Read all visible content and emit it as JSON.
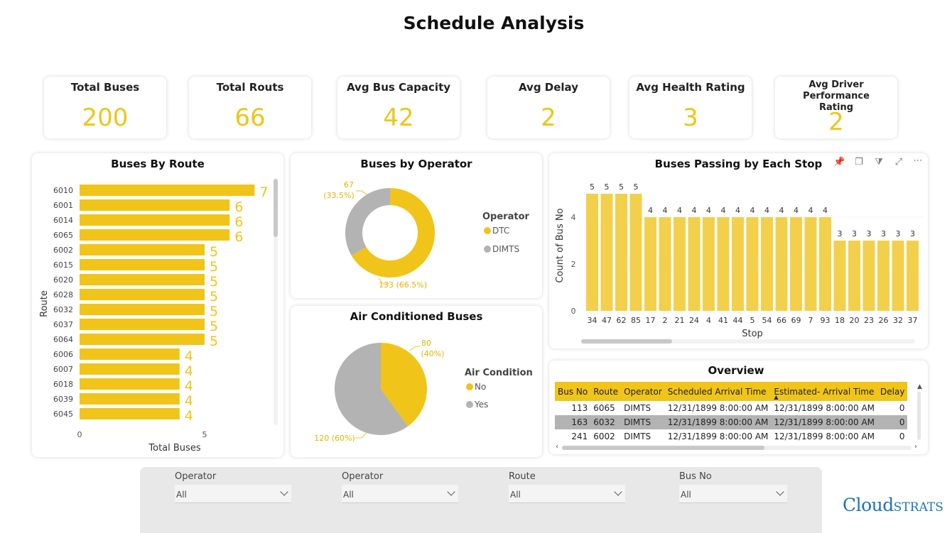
{
  "page_title": "Schedule Analysis",
  "kpis": [
    {
      "label": "Total Buses",
      "value": "200"
    },
    {
      "label": "Total Routs",
      "value": "66"
    },
    {
      "label": "Avg Bus Capacity",
      "value": "42"
    },
    {
      "label": "Avg Delay",
      "value": "2"
    },
    {
      "label": "Avg Health Rating",
      "value": "3"
    },
    {
      "label": "Avg Driver Performance Rating",
      "value": "2"
    }
  ],
  "colors": {
    "accent": "#f0c419",
    "grey": "#b3b3b3",
    "bar": "#f2d04b"
  },
  "route_chart": {
    "title": "Buses By Route",
    "xlabel": "Total Buses",
    "ylabel": "Route",
    "x_ticks": [
      "0",
      "5"
    ],
    "categories": [
      "6010",
      "6001",
      "6014",
      "6065",
      "6002",
      "6015",
      "6020",
      "6028",
      "6032",
      "6037",
      "6064",
      "6006",
      "6007",
      "6018",
      "6039",
      "6045"
    ],
    "values": [
      7,
      6,
      6,
      6,
      5,
      5,
      5,
      5,
      5,
      5,
      5,
      4,
      4,
      4,
      4,
      4
    ]
  },
  "operator_chart": {
    "title": "Buses by Operator",
    "legend_title": "Operator",
    "slices": [
      {
        "name": "DTC",
        "value": 133,
        "label": "133 (66.5%)",
        "color": "#f0c419"
      },
      {
        "name": "DIMTS",
        "value": 67,
        "label_line1": "67",
        "label_line2": "(33.5%)",
        "color": "#b3b3b3"
      }
    ]
  },
  "ac_chart": {
    "title": "Air Conditioned Buses",
    "legend_title": "Air Condition",
    "slices": [
      {
        "name": "No",
        "value": 80,
        "label_line1": "80",
        "label_line2": "(40%)",
        "color": "#f0c419"
      },
      {
        "name": "Yes",
        "value": 120,
        "label": "120 (60%)",
        "color": "#b3b3b3"
      }
    ]
  },
  "stop_chart": {
    "title": "Buses Passing by Each Stop",
    "xlabel": "Stop",
    "ylabel": "Count of Bus No",
    "y_ticks": [
      0,
      2,
      4
    ],
    "ylim": [
      0,
      5.5
    ],
    "categories": [
      "34",
      "47",
      "62",
      "85",
      "17",
      "2",
      "21",
      "24",
      "4",
      "41",
      "44",
      "5",
      "54",
      "66",
      "69",
      "7",
      "93",
      "18",
      "20",
      "23",
      "26",
      "32",
      "37"
    ],
    "values": [
      5,
      5,
      5,
      5,
      4,
      4,
      4,
      4,
      4,
      4,
      4,
      4,
      4,
      4,
      4,
      4,
      4,
      3,
      3,
      3,
      3,
      3,
      3
    ]
  },
  "overview": {
    "title": "Overview",
    "columns": [
      "Bus No",
      "Route",
      "Operator",
      "Scheduled Arrival Time",
      "Estimated- Arrival Time",
      "Delay"
    ],
    "rows": [
      [
        "113",
        "6065",
        "DIMTS",
        "12/31/1899 8:00:00 AM",
        "12/31/1899 8:00:00 AM",
        "0"
      ],
      [
        "163",
        "6032",
        "DIMTS",
        "12/31/1899 8:00:00 AM",
        "12/31/1899 8:00:00 AM",
        "0"
      ],
      [
        "241",
        "6002",
        "DIMTS",
        "12/31/1899 8:00:00 AM",
        "12/31/1899 8:00:00 AM",
        "0"
      ]
    ]
  },
  "slicers": [
    {
      "label": "Operator",
      "value": "All"
    },
    {
      "label": "Operator",
      "value": "All"
    },
    {
      "label": "Route",
      "value": "All"
    },
    {
      "label": "Bus No",
      "value": "All"
    }
  ],
  "logo": {
    "part1": "Cloud",
    "part2": "STRATS"
  }
}
